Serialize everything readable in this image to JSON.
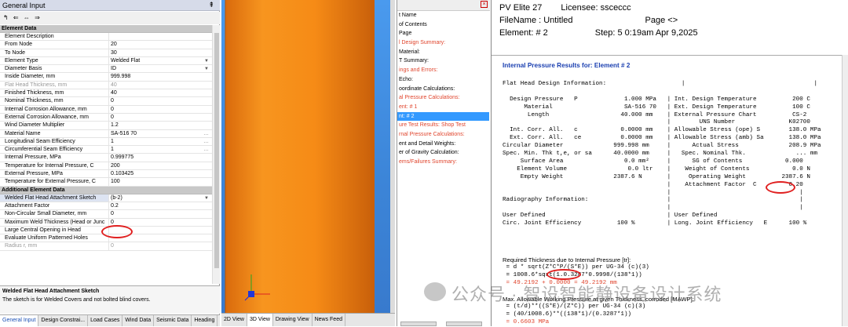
{
  "left_panel": {
    "title": "General Input",
    "pin": "⇞",
    "tool_icons": "↰ ⇐ ⇔ ⇒",
    "sections": [
      {
        "name": "Element Data",
        "rows": [
          {
            "k": "Element Description",
            "v": ""
          },
          {
            "k": "From Node",
            "v": "20"
          },
          {
            "k": "To Node",
            "v": "30"
          },
          {
            "k": "Element Type",
            "v": "Welded Flat",
            "dd": true
          },
          {
            "k": "Diameter Basis",
            "v": "ID",
            "dd": true
          },
          {
            "k": "Inside Diameter, mm",
            "v": "999.998"
          },
          {
            "k": "Flat Head Thickness, mm",
            "v": "40",
            "dis": true
          },
          {
            "k": "Finished Thickness, mm",
            "v": "40"
          },
          {
            "k": "Nominal Thickness, mm",
            "v": "0"
          },
          {
            "k": "Internal Corrosion Allowance, mm",
            "v": "0"
          },
          {
            "k": "External Corrosion Allowance, mm",
            "v": "0"
          },
          {
            "k": "Wind Diameter Multiplier",
            "v": "1.2"
          },
          {
            "k": "Material Name",
            "v": "SA-516 70",
            "dots": true
          },
          {
            "k": "Longitudinal Seam Efficiency",
            "v": "1",
            "dots": true
          },
          {
            "k": "Circumferential Seam Efficiency",
            "v": "1",
            "dots": true
          },
          {
            "k": "Internal Pressure, MPa",
            "v": "0.999775"
          },
          {
            "k": "Temperature for Internal Pressure, C",
            "v": "200"
          },
          {
            "k": "External Pressure, MPa",
            "v": "0.103425"
          },
          {
            "k": "Temperature for External Pressure, C",
            "v": "100"
          }
        ]
      },
      {
        "name": "Additional Element Data",
        "rows": [
          {
            "k": "Welded Flat Head Attachment Sketch",
            "v": "(b-2)",
            "dd": true,
            "sel": true
          },
          {
            "k": "Attachment Factor",
            "v": "0.2"
          },
          {
            "k": "Non-Circular Small Diameter, mm",
            "v": "0"
          },
          {
            "k": "Maximum Weld Thickness (Head or Junc",
            "v": "0"
          },
          {
            "k": "Large Central Opening in Head",
            "v": ""
          },
          {
            "k": "Evaluate Uniform Patterned Holes",
            "v": ""
          },
          {
            "k": "Radius r, mm",
            "v": "0",
            "dis": true
          }
        ]
      }
    ],
    "desc_title": "Welded Flat Head Attachment Sketch",
    "desc_text": "The sketch is for Welded Covers and not bolted blind covers.",
    "tabs": [
      "General Input",
      "Design Constrai...",
      "Load Cases",
      "Wind Data",
      "Seismic Data",
      "Heading"
    ]
  },
  "view": {
    "tabs": [
      "2D View",
      "3D View",
      "Drawing View",
      "News Feed"
    ],
    "colors": {
      "cylinder": "#f08a1a",
      "sky": "#4a9aee"
    }
  },
  "tree": {
    "items": [
      {
        "t": "t Name",
        "c": ""
      },
      {
        "t": "of Contents",
        "c": ""
      },
      {
        "t": "Page",
        "c": ""
      },
      {
        "t": "l Design Summary:",
        "c": "red"
      },
      {
        "t": "Material:",
        "c": ""
      },
      {
        "t": "T Summary:",
        "c": ""
      },
      {
        "t": "ings and Errors:",
        "c": "red"
      },
      {
        "t": "Echo:",
        "c": ""
      },
      {
        "t": "oordinate Calculations:",
        "c": ""
      },
      {
        "t": "al Pressure Calculations:",
        "c": "red"
      },
      {
        "t": "ent: # 1",
        "c": "red"
      },
      {
        "t": "nt: # 2",
        "c": "sel"
      },
      {
        "t": "ure Test Results: Shop Test",
        "c": "red"
      },
      {
        "t": "rnal Pressure Calculations:",
        "c": "red"
      },
      {
        "t": "ent and Detail Weights:",
        "c": ""
      },
      {
        "t": "er of Gravity Calculation:",
        "c": ""
      },
      {
        "t": "ems/Failures Summary:",
        "c": "red"
      }
    ]
  },
  "report": {
    "app": "PV Elite 27",
    "licensee": "Licensee: ssceccc",
    "filename": "FileName : Untitled",
    "page": "Page <>",
    "element": "Element: # 2",
    "step": "Step:   5  0:19am  Apr 9,2025",
    "section_title": "Internal Pressure Results for: Element # 2",
    "lines": [
      "",
      "Flat Head Design Information:                     |                                    |",
      "",
      "  Design Pressure   P             1.000 MPa   | Int. Design Temperature          200 C",
      "      Material                    SA-516 70   | Ext. Design Temperature          100 C",
      "       Length                    40.000 mm    | External Pressure Chart          CS-2",
      "                                              |        UNS Number               K02700",
      "  Int. Corr. All.   c            0.0000 mm    | Allowable Stress (ope) S        138.0 MPa",
      "  Ext. Corr. All.   ce           0.0000 mm    | Allowable Stress (amb) Sa       138.0 MPa",
      "Circular Diameter              999.998 mm     |      Actual Stress              208.9 MPa",
      "Spec. Min. Thk t,e, or sa      40.0000 mm     |   Spec. Nominal Thk.              ... mm",
      "     Surface Area                 0.0 mm²     |      SG of Contents            0.000",
      "    Element Volume                 0.0 ltr    |    Weight of Contents            0.0 N",
      "     Empty Weight              2387.6 N       |     Operating Weight          2387.6 N",
      "                                              |    Attachment Factor  C         0.20",
      "                                              |                                    |",
      "Radiography Information:                      |                                    |",
      "                                              |                                    |",
      "User Defined                                  | User Defined",
      "Circ. Joint Efficiency          100 %         | Long. Joint Efficiency   E      100 %"
    ],
    "req_title": "Required Thickness due to Internal Pressure [tr]:",
    "req_lines": [
      {
        "t": " = d * sqrt(Z*C*P/(S*E)) per UG-34 (c)(3)",
        "red": false
      },
      {
        "t": " = 1008.6*sqrt(1.0.3287*0.9998/(138*1))",
        "red": false
      },
      {
        "t": " = 49.2192 + 0.0000 = 49.2192 mm",
        "red": true
      }
    ],
    "mawp_title": "Max. Allowable Working Pressure at given Thickness, corroded [MAWP]:",
    "mawp_lines": [
      {
        "t": " = (t/d)**((S*E)/(Z*C)) per UG-34 (c)(3)",
        "red": false
      },
      {
        "t": " = (40/1008.6)**((138*1)/(0.3287*1))",
        "red": false
      },
      {
        "t": " = 0.6603 MPa",
        "red": true
      }
    ]
  },
  "watermark": "公众号 · 智设智能静设备设计系统"
}
